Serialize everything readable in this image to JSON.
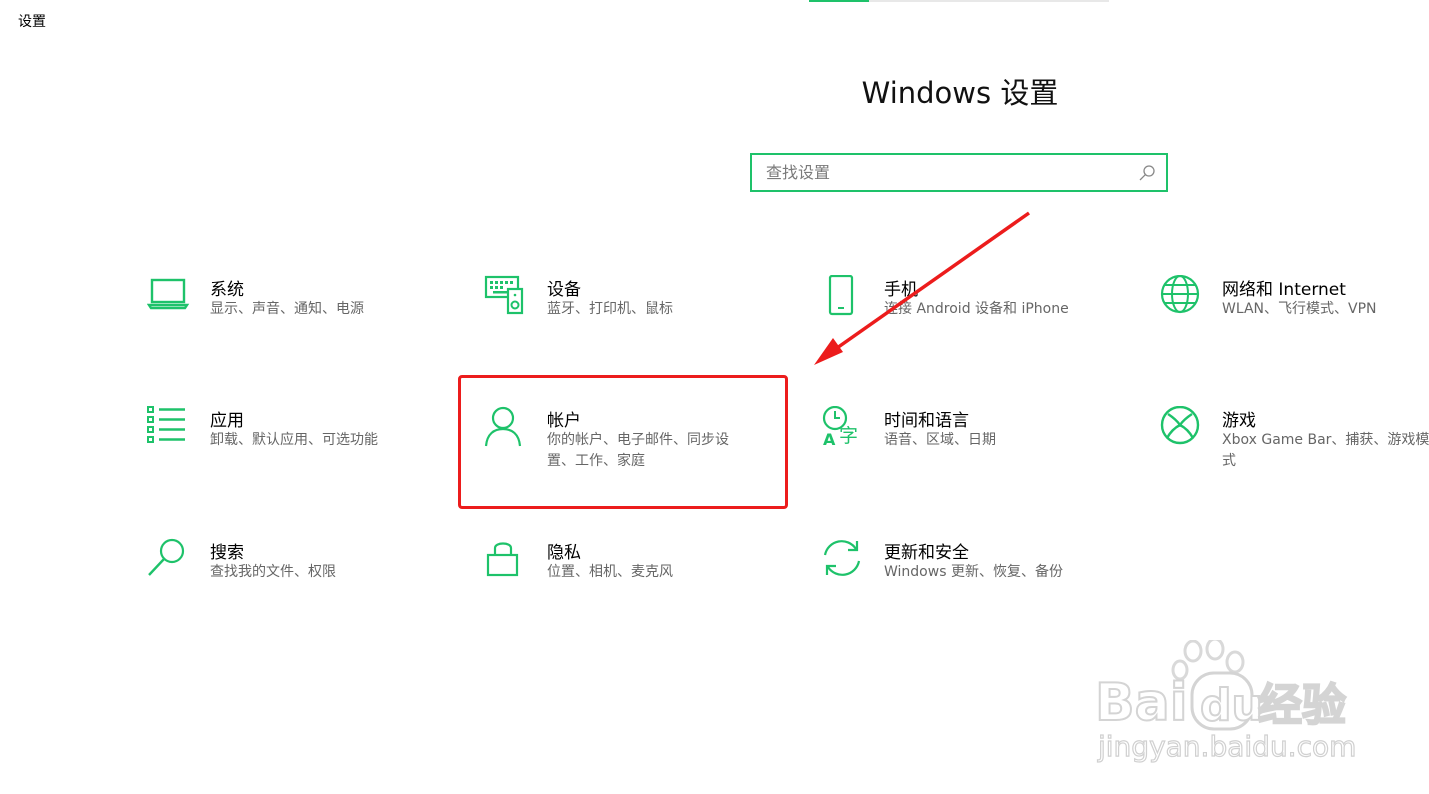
{
  "window": {
    "title": "设置"
  },
  "header": {
    "title": "Windows 设置"
  },
  "search": {
    "placeholder": "查找设置"
  },
  "tiles": [
    {
      "label": "系统",
      "desc": "显示、声音、通知、电源",
      "icon": "laptop-icon"
    },
    {
      "label": "设备",
      "desc": "蓝牙、打印机、鼠标",
      "icon": "devices-icon"
    },
    {
      "label": "手机",
      "desc": "连接 Android 设备和 iPhone",
      "icon": "phone-icon"
    },
    {
      "label": "网络和 Internet",
      "desc": "WLAN、飞行模式、VPN",
      "icon": "globe-icon"
    },
    {
      "label": "应用",
      "desc": "卸载、默认应用、可选功能",
      "icon": "apps-list-icon"
    },
    {
      "label": "帐户",
      "desc": "你的帐户、电子邮件、同步设置、工作、家庭",
      "icon": "person-icon"
    },
    {
      "label": "时间和语言",
      "desc": "语音、区域、日期",
      "icon": "time-language-icon"
    },
    {
      "label": "游戏",
      "desc": "Xbox Game Bar、捕获、游戏模式",
      "icon": "xbox-icon"
    },
    {
      "label": "搜索",
      "desc": "查找我的文件、权限",
      "icon": "search-magnifier-icon"
    },
    {
      "label": "隐私",
      "desc": "位置、相机、麦克风",
      "icon": "lock-icon"
    },
    {
      "label": "更新和安全",
      "desc": "Windows 更新、恢复、备份",
      "icon": "sync-icon"
    }
  ],
  "watermark": {
    "brand": "Baidu经验",
    "url": "jingyan.baidu.com"
  },
  "colors": {
    "accent": "#1ec26a",
    "annotation": "#ec1c1c"
  }
}
